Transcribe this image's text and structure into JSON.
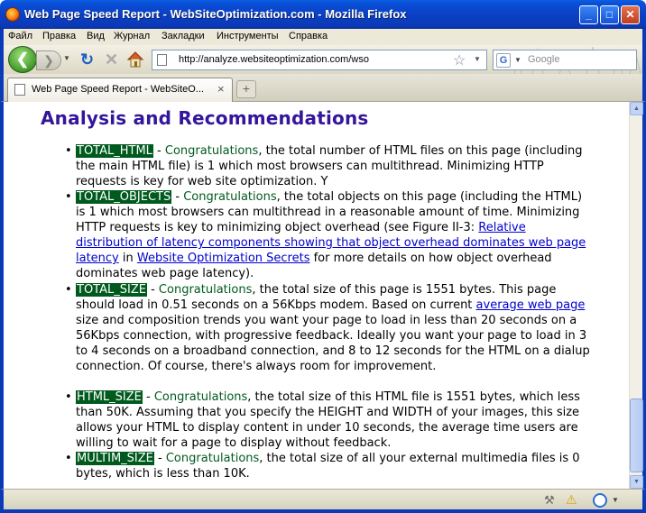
{
  "window": {
    "title": "Web Page Speed Report - WebSiteOptimization.com - Mozilla Firefox",
    "minimize_label": "_",
    "maximize_label": "□",
    "close_label": "✕"
  },
  "menu": [
    "Файл",
    "Правка",
    "Вид",
    "Журнал",
    "Закладки",
    "Инструменты",
    "Справка"
  ],
  "navbar": {
    "back_icon": "back-arrow-icon",
    "url": "http://analyze.websiteoptimization.com/wso",
    "search_placeholder": "Google",
    "search_engine_letter": "G"
  },
  "tabs": [
    {
      "title": "Web Page Speed Report - WebSiteO...",
      "close": "×"
    }
  ],
  "new_tab_label": "+",
  "page": {
    "heading": "Analysis and Recommendations",
    "recommendations": [
      {
        "code": "TOTAL_HTML",
        "sep": " - ",
        "status": "Congratulations",
        "text": ", the total number of HTML files on this page (including the main HTML file) is 1 which most browsers can multithread. Minimizing HTTP requests is key for web site optimization. Y"
      },
      {
        "code": "TOTAL_OBJECTS",
        "sep": " - ",
        "status": "Congratulations",
        "text_before_link": ", the total objects on this page (including the HTML) is 1 which most browsers can multithread in a reasonable amount of time. Minimizing HTTP requests is key to minimizing object overhead (see Figure II-3: ",
        "link1": "Relative distribution of latency components showing that object overhead dominates web page latency",
        "text_mid": " in ",
        "link2": "Website Optimization Secrets",
        "text_after": " for more details on how object overhead dominates web page latency)."
      },
      {
        "code": "TOTAL_SIZE",
        "sep": " - ",
        "status": "Congratulations",
        "text_before_link": ", the total size of this page is 1551 bytes. This page should load in 0.51 seconds on a 56Kbps modem. Based on current ",
        "link1": "average web page",
        "text_after": " size and composition trends you want your page to load in less than 20 seconds on a 56Kbps connection, with progressive feedback. Ideally you want your page to load in 3 to 4 seconds on a broadband connection, and 8 to 12 seconds for the HTML on a dialup connection. Of course, there's always room for improvement."
      },
      {
        "code": "HTML_SIZE",
        "sep": " - ",
        "status": "Congratulations",
        "text": ", the total size of this HTML file is 1551 bytes, which less than 50K. Assuming that you specify the HEIGHT and WIDTH of your images, this size allows your HTML to display content in under 10 seconds, the average time users are willing to wait for a page to display without feedback."
      },
      {
        "code": "MULTIM_SIZE",
        "sep": " - ",
        "status": "Congratulations",
        "text": ", the total size of all your external multimedia files is 0 bytes, which is less than 10K."
      }
    ]
  },
  "colors": {
    "heading": "#33169b",
    "tag_bg": "#005a1e",
    "congrats": "#005a1e",
    "link": "#0000cc",
    "window_frame": "#0a3ab8"
  }
}
